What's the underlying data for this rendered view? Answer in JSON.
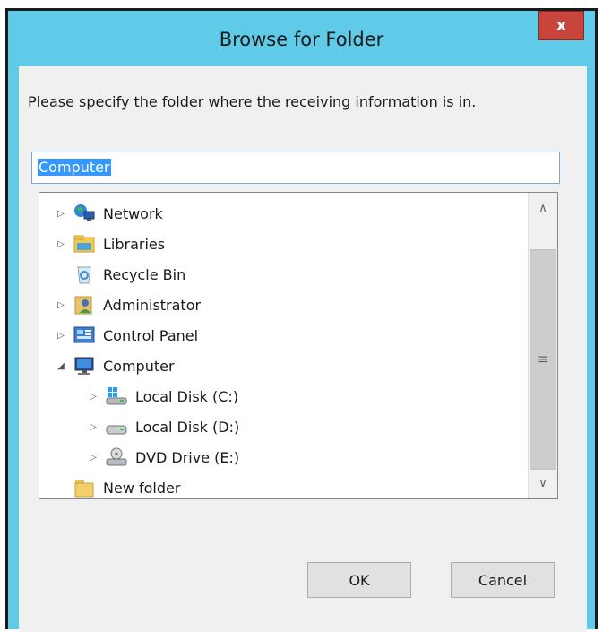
{
  "dialog": {
    "title": "Browse for Folder",
    "close_label": "x",
    "prompt": "Please specify the folder where the receiving information is in.",
    "path_value": "Computer"
  },
  "tree": {
    "items": [
      {
        "label": "Network",
        "expander": "▷",
        "icon": "network-icon"
      },
      {
        "label": "Libraries",
        "expander": "▷",
        "icon": "libraries-icon"
      },
      {
        "label": "Recycle Bin",
        "expander": "",
        "icon": "recycle-bin-icon"
      },
      {
        "label": "Administrator",
        "expander": "▷",
        "icon": "user-folder-icon"
      },
      {
        "label": "Control Panel",
        "expander": "▷",
        "icon": "control-panel-icon"
      },
      {
        "label": "Computer",
        "expander": "◢",
        "icon": "computer-icon"
      },
      {
        "label": "Local Disk (C:)",
        "expander": "▷",
        "icon": "system-disk-icon"
      },
      {
        "label": "Local Disk (D:)",
        "expander": "▷",
        "icon": "disk-icon"
      },
      {
        "label": "DVD Drive (E:)",
        "expander": "▷",
        "icon": "dvd-drive-icon"
      },
      {
        "label": "New folder",
        "expander": "",
        "icon": "folder-icon"
      }
    ]
  },
  "scrollbar": {
    "up_arrow": "∧",
    "down_arrow": "∨",
    "grip": "≡"
  },
  "buttons": {
    "ok": "OK",
    "cancel": "Cancel"
  },
  "colors": {
    "frame": "#5fcbe9",
    "close": "#c7453a",
    "selection": "#3399ff"
  }
}
